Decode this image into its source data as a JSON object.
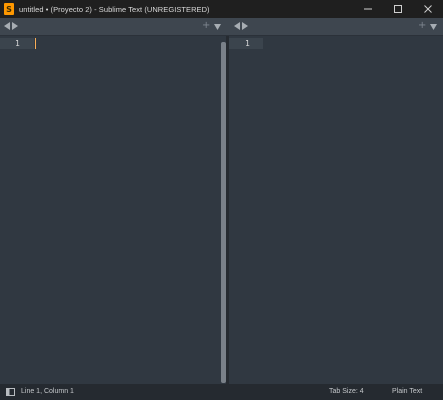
{
  "window": {
    "title": "untitled • (Proyecto 2) - Sublime Text (UNREGISTERED)",
    "app_icon_glyph": "S",
    "controls": [
      "minimize-icon",
      "maximize-icon",
      "close-icon"
    ]
  },
  "panes": [
    {
      "line_number": "1",
      "has_caret": true
    },
    {
      "line_number": "1",
      "has_caret": false
    }
  ],
  "tabstrip": {
    "plus_label": "+",
    "icons": [
      "arrow-left-icon",
      "arrow-right-icon",
      "plus-icon",
      "dropdown-icon"
    ]
  },
  "statusbar": {
    "position": "Line 1, Column 1",
    "tab_size": "Tab Size: 4",
    "syntax": "Plain Text"
  },
  "colors": {
    "background": "#303841",
    "caret": "#f9ae58",
    "titlebar": "#1f1f1f",
    "statusbar": "#252a30"
  }
}
